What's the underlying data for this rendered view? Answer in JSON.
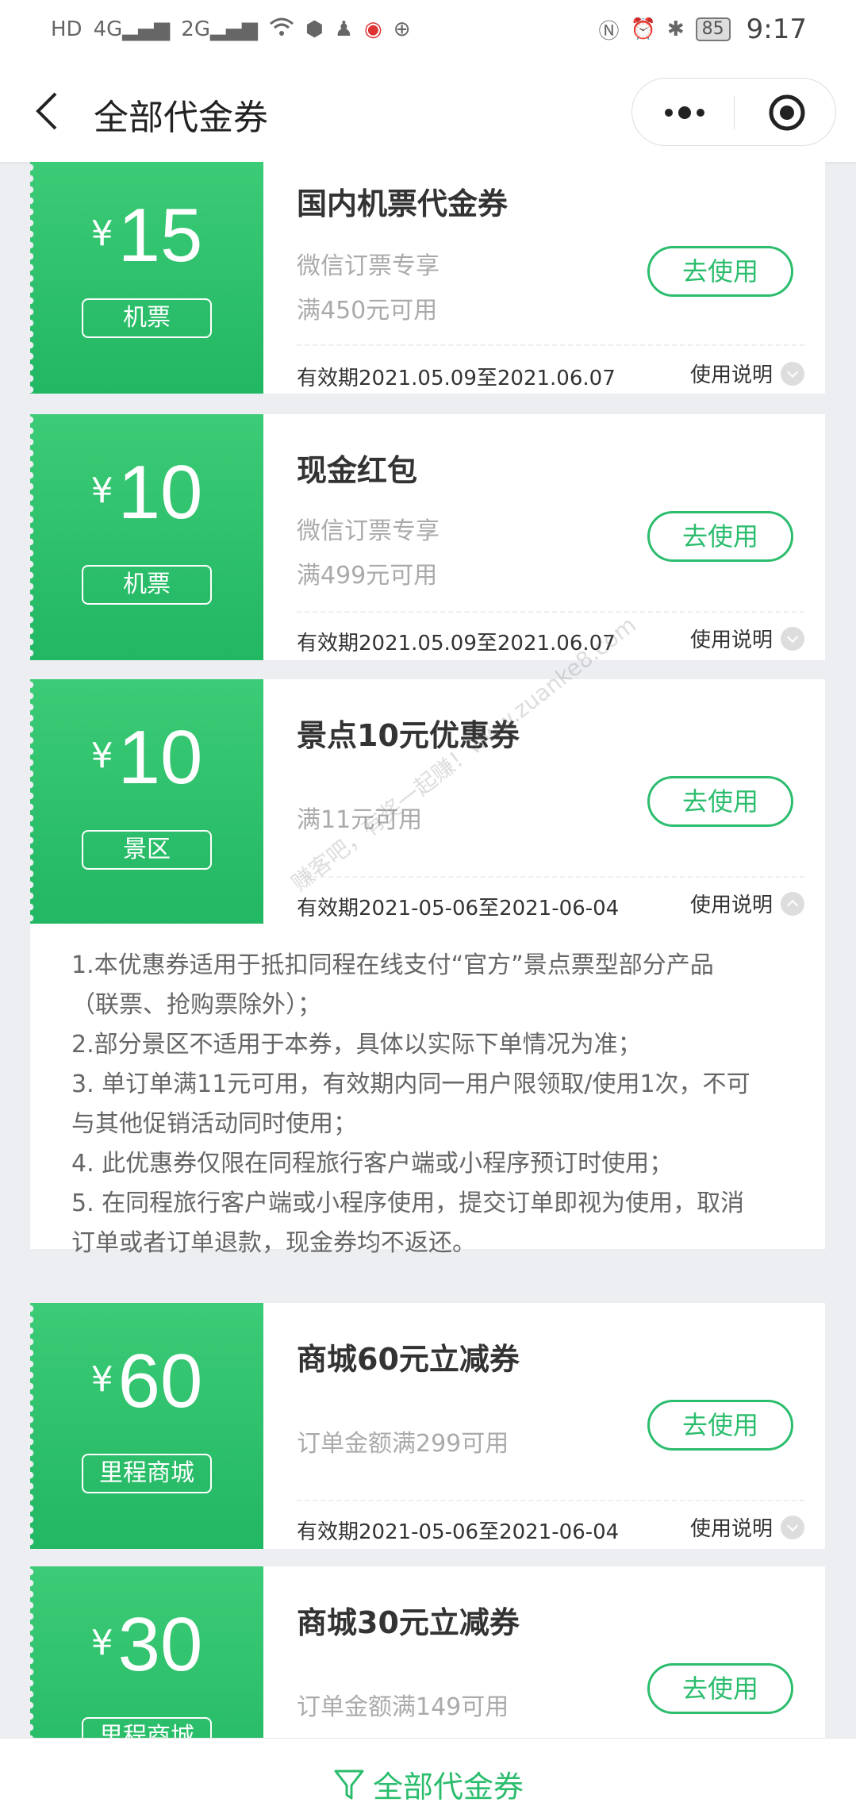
{
  "status_bar": {
    "left_icons": [
      "hd-icon",
      "4g-signal-icon",
      "2g-signal-icon",
      "wifi-icon",
      "shield-icon",
      "qq-icon",
      "weibo-icon",
      "globe-icon"
    ],
    "left_text": {
      "hd": "HD",
      "net1": "4G",
      "net2": "2G"
    },
    "battery": "85",
    "time": "9:17"
  },
  "nav": {
    "title": "全部代金券"
  },
  "coupons": [
    {
      "currency": "¥",
      "amount": "15",
      "tag": "机票",
      "title": "国内机票代金券",
      "lines": [
        "微信订票专享",
        "满450元可用"
      ],
      "button": "去使用",
      "validity": "有效期2021.05.09至2021.06.07",
      "instructions": "使用说明"
    },
    {
      "currency": "¥",
      "amount": "10",
      "tag": "机票",
      "title": "现金红包",
      "lines": [
        "微信订票专享",
        "满499元可用"
      ],
      "button": "去使用",
      "validity": "有效期2021.05.09至2021.06.07",
      "instructions": "使用说明"
    },
    {
      "currency": "¥",
      "amount": "10",
      "tag": "景区",
      "title": "景点10元优惠券",
      "lines": [
        "满11元可用"
      ],
      "button": "去使用",
      "validity": "有效期2021-05-06至2021-06-04",
      "instructions": "使用说明"
    },
    {
      "currency": "¥",
      "amount": "60",
      "tag": "里程商城",
      "title": "商城60元立减券",
      "lines": [
        "订单金额满299可用"
      ],
      "button": "去使用",
      "validity": "有效期2021-05-06至2021-06-04",
      "instructions": "使用说明"
    },
    {
      "currency": "¥",
      "amount": "30",
      "tag": "里程商城",
      "title": "商城30元立减券",
      "lines": [
        "订单金额满149可用"
      ],
      "button": "去使用"
    }
  ],
  "rules": [
    "1.本优惠券适用于抵扣同程在线支付“官方”景点票型部分产品",
    "（联票、抢购票除外）；",
    "2.部分景区不适用于本券，具体以实际下单情况为准；",
    "3. 单订单满11元可用，有效期内同一用户限领取/使用1次，不可",
    "与其他促销活动同时使用；",
    "4. 此优惠券仅限在同程旅行客户端或小程序预订时使用；",
    "5. 在同程旅行客户端或小程序使用，提交订单即视为使用，取消",
    "订单或者订单退款，现金券均不返还。"
  ],
  "watermark": "赚客吧，有奖一起赚！www.zuanke8.com",
  "bottom": {
    "filter_label": "全部代金券"
  },
  "colors": {
    "accent": "#2bbd6d",
    "stub": "#2ec26c",
    "background": "#eceef2"
  }
}
